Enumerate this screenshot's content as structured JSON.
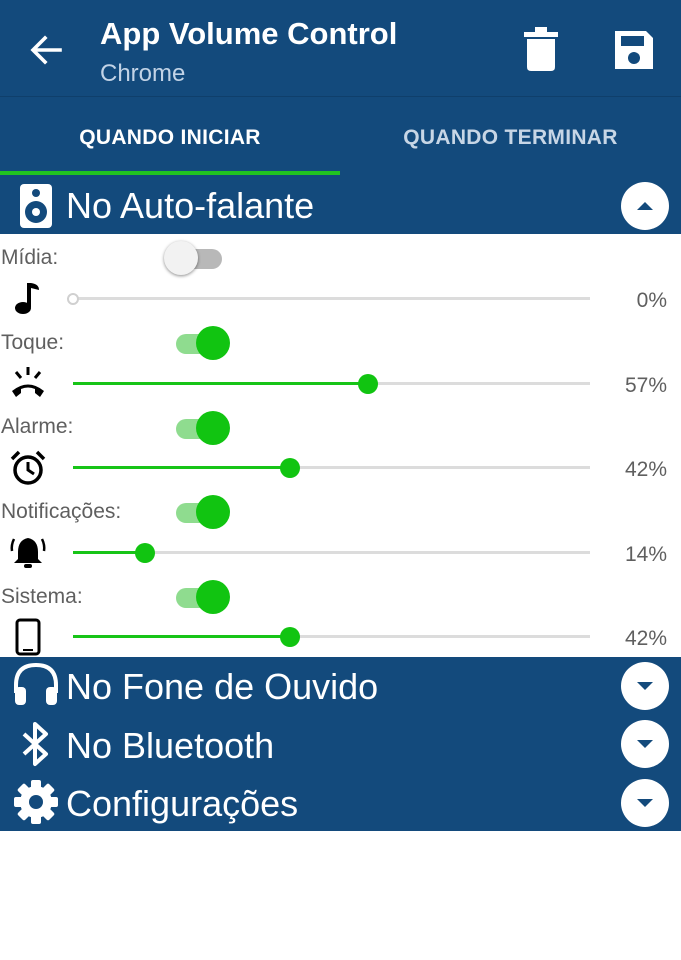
{
  "appbar": {
    "title": "App Volume Control",
    "subtitle": "Chrome",
    "back_icon": "arrow-left-icon",
    "delete_icon": "trash-icon",
    "save_icon": "floppy-disk-icon"
  },
  "tabs": [
    {
      "label": "QUANDO INICIAR",
      "selected": true
    },
    {
      "label": "QUANDO TERMINAR",
      "selected": false
    }
  ],
  "colors": {
    "primary": "#134a7c",
    "accent": "#11c411",
    "text": "#5f5f5f"
  },
  "speaker_section": {
    "title": "No Auto-falante",
    "expanded": true,
    "icon": "speaker-icon",
    "streams": [
      {
        "label": "Mídia:",
        "enabled": false,
        "icon": "music-note-icon",
        "percent": "0%",
        "value": 0
      },
      {
        "label": "Toque:",
        "enabled": true,
        "icon": "ringing-phone-icon",
        "percent": "57%",
        "value": 57
      },
      {
        "label": "Alarme:",
        "enabled": true,
        "icon": "alarm-clock-icon",
        "percent": "42%",
        "value": 42
      },
      {
        "label": "Notificações:",
        "enabled": true,
        "icon": "bell-ringing-icon",
        "percent": "14%",
        "value": 14
      },
      {
        "label": "Sistema:",
        "enabled": true,
        "icon": "smartphone-icon",
        "percent": "42%",
        "value": 42
      }
    ]
  },
  "collapsed_sections": [
    {
      "title": "No Fone de Ouvido",
      "icon": "headphones-icon",
      "expanded": false
    },
    {
      "title": "No Bluetooth",
      "icon": "bluetooth-icon",
      "expanded": false
    },
    {
      "title": "Configurações",
      "icon": "gear-icon",
      "expanded": false
    }
  ]
}
